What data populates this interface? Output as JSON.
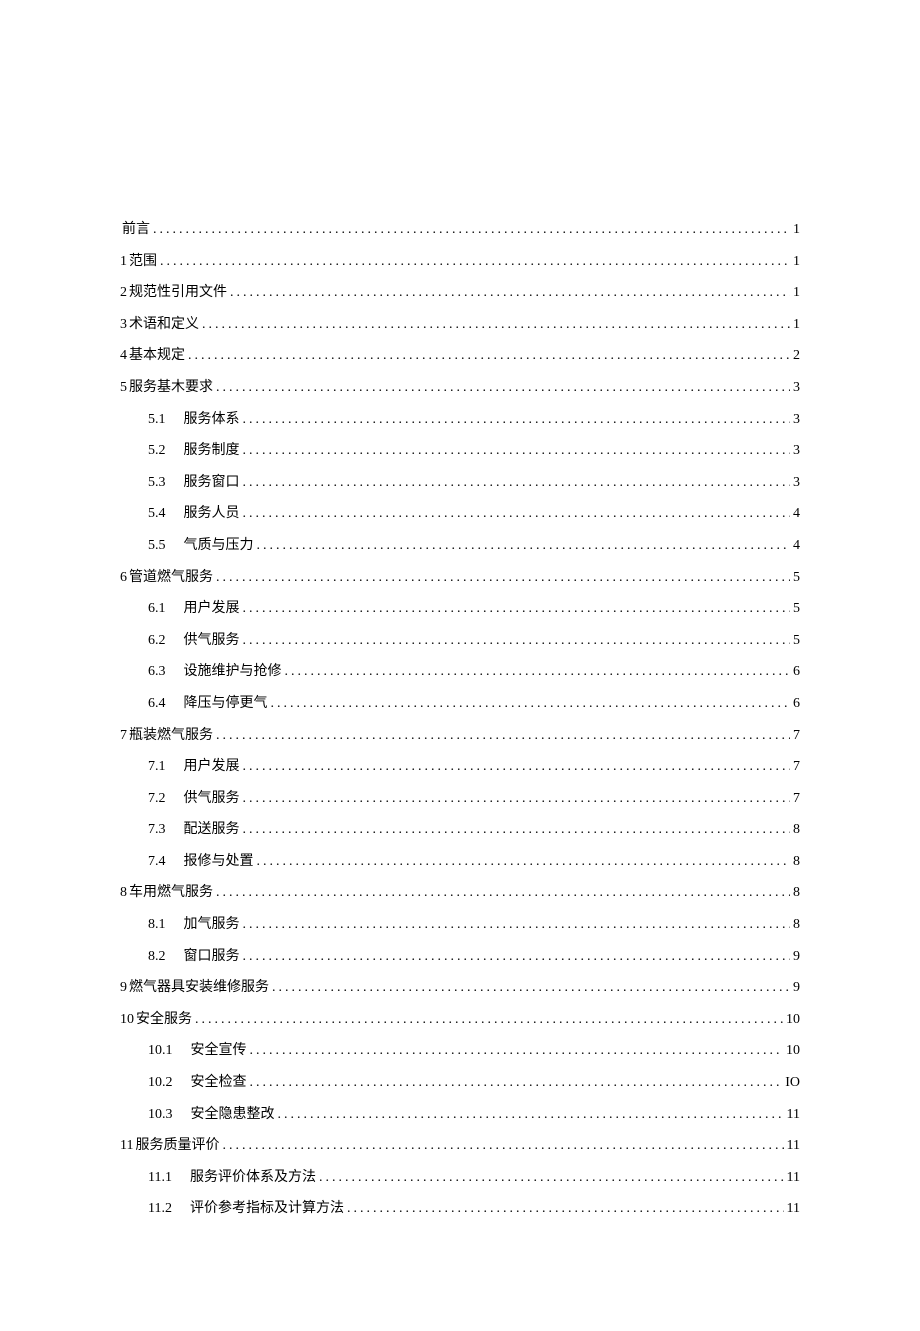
{
  "toc": [
    {
      "num": "",
      "title": "前言",
      "page": "1",
      "sub": false
    },
    {
      "num": "1",
      "title": "范围",
      "page": "1",
      "sub": false
    },
    {
      "num": "2",
      "title": "规范性引用文件",
      "page": "1",
      "sub": false
    },
    {
      "num": "3",
      "title": "术语和定义",
      "page": "1",
      "sub": false
    },
    {
      "num": "4",
      "title": "基本规定",
      "page": "2",
      "sub": false
    },
    {
      "num": "5",
      "title": "服务基木要求",
      "page": "3",
      "sub": false
    },
    {
      "num": "5.1",
      "title": "服务体系",
      "page": "3",
      "sub": true
    },
    {
      "num": "5.2",
      "title": "服务制度",
      "page": "3",
      "sub": true
    },
    {
      "num": "5.3",
      "title": "服务窗口",
      "page": "3",
      "sub": true
    },
    {
      "num": "5.4",
      "title": "服务人员",
      "page": "4",
      "sub": true
    },
    {
      "num": "5.5",
      "title": "气质与压力",
      "page": "4",
      "sub": true
    },
    {
      "num": "6",
      "title": "管道燃气服务",
      "page": "5",
      "sub": false
    },
    {
      "num": "6.1",
      "title": "用户发展",
      "page": "5",
      "sub": true
    },
    {
      "num": "6.2",
      "title": "供气服务",
      "page": "5",
      "sub": true
    },
    {
      "num": "6.3",
      "title": "设施维护与抢修",
      "page": "6",
      "sub": true
    },
    {
      "num": "6.4",
      "title": "降压与停更气",
      "page": "6",
      "sub": true
    },
    {
      "num": "7",
      "title": "瓶装燃气服务",
      "page": "7",
      "sub": false
    },
    {
      "num": "7.1",
      "title": "用户发展",
      "page": "7",
      "sub": true
    },
    {
      "num": "7.2",
      "title": "供气服务",
      "page": "7",
      "sub": true
    },
    {
      "num": "7.3",
      "title": "配送服务",
      "page": "8",
      "sub": true
    },
    {
      "num": "7.4",
      "title": "报修与处置",
      "page": "8",
      "sub": true
    },
    {
      "num": "8",
      "title": "车用燃气服务",
      "page": "8",
      "sub": false
    },
    {
      "num": "8.1",
      "title": "加气服务",
      "page": "8",
      "sub": true
    },
    {
      "num": "8.2",
      "title": "窗口服务",
      "page": "9",
      "sub": true
    },
    {
      "num": "9",
      "title": "燃气器具安装维修服务",
      "page": "9",
      "sub": false
    },
    {
      "num": "10",
      "title": "安全服务",
      "page": "10",
      "sub": false
    },
    {
      "num": "10.1",
      "title": "安全宣传",
      "page": "10",
      "sub": true
    },
    {
      "num": "10.2",
      "title": "安全检查",
      "page": "IO",
      "sub": true
    },
    {
      "num": "10.3",
      "title": "安全隐患整改",
      "page": "11",
      "sub": true
    },
    {
      "num": "11",
      "title": "服务质量评价",
      "page": "11",
      "sub": false
    },
    {
      "num": "11.1",
      "title": "服务评价体系及方法",
      "page": "11",
      "sub": true
    },
    {
      "num": "11.2",
      "title": "评价参考指标及计算方法",
      "page": "11",
      "sub": true
    }
  ]
}
